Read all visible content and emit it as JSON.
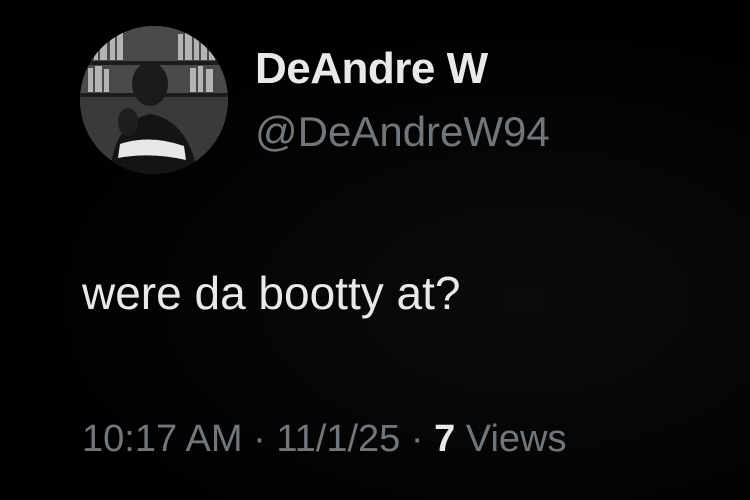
{
  "author": {
    "display_name": "DeAndre W",
    "handle": "@DeAndreW94",
    "avatar_icon": "profile-photo"
  },
  "tweet": {
    "text": "were da bootty at?",
    "time": "10:17 AM",
    "separator": "·",
    "date": "11/1/25",
    "views_count": "7",
    "views_label": "Views"
  },
  "colors": {
    "background": "#000000",
    "primary_text": "#e7e9ea",
    "secondary_text": "#71767b"
  }
}
